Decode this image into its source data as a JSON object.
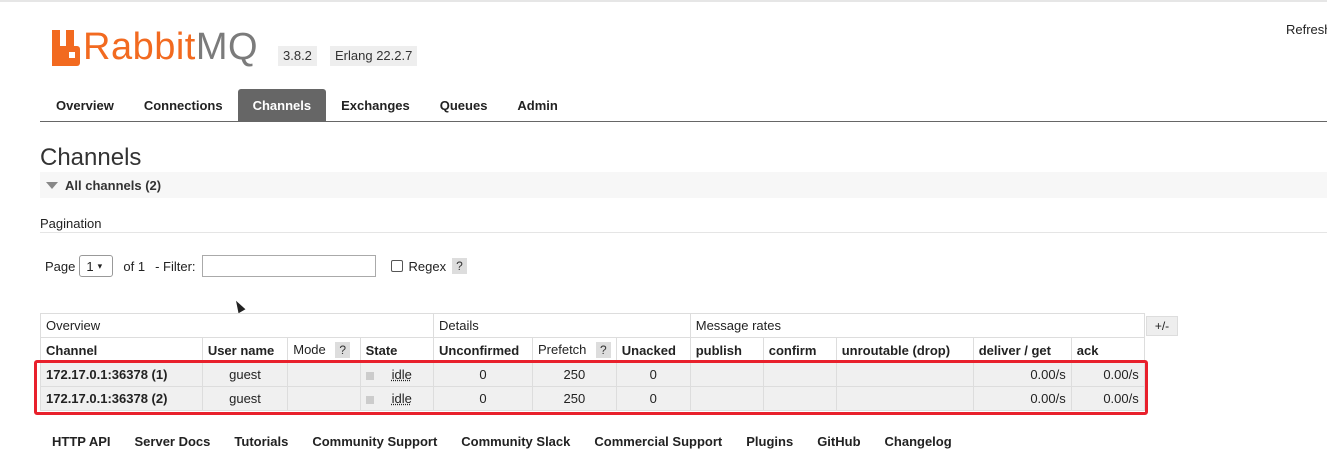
{
  "app": {
    "logo_rabbit": "Rabbit",
    "logo_mq": "MQ",
    "version": "3.8.2",
    "erlang": "Erlang 22.2.7",
    "refresh": "Refresh"
  },
  "tabs": [
    {
      "label": "Overview"
    },
    {
      "label": "Connections"
    },
    {
      "label": "Channels",
      "active": true
    },
    {
      "label": "Exchanges"
    },
    {
      "label": "Queues"
    },
    {
      "label": "Admin"
    }
  ],
  "page": {
    "title": "Channels",
    "section": "All channels (2)",
    "pagination_label": "Pagination"
  },
  "pager": {
    "page_label": "Page",
    "page_value": "1",
    "of_label": "of 1",
    "filter_label": "- Filter:",
    "filter_value": "",
    "regex_label": "Regex",
    "help": "?"
  },
  "table": {
    "groups": [
      "Overview",
      "Details",
      "Message rates"
    ],
    "columns": [
      "Channel",
      "User name",
      "Mode",
      "State",
      "Unconfirmed",
      "Prefetch",
      "Unacked",
      "publish",
      "confirm",
      "unroutable (drop)",
      "deliver / get",
      "ack"
    ],
    "plus_minus": "+/-",
    "rows": [
      {
        "channel": "172.17.0.1:36378 (1)",
        "user": "guest",
        "mode": "",
        "state": "idle",
        "unconfirmed": "0",
        "prefetch": "250",
        "unacked": "0",
        "publish": "",
        "confirm": "",
        "unroutable": "",
        "deliver": "0.00/s",
        "ack": "0.00/s"
      },
      {
        "channel": "172.17.0.1:36378 (2)",
        "user": "guest",
        "mode": "",
        "state": "idle",
        "unconfirmed": "0",
        "prefetch": "250",
        "unacked": "0",
        "publish": "",
        "confirm": "",
        "unroutable": "",
        "deliver": "0.00/s",
        "ack": "0.00/s"
      }
    ]
  },
  "footer": [
    "HTTP API",
    "Server Docs",
    "Tutorials",
    "Community Support",
    "Community Slack",
    "Commercial Support",
    "Plugins",
    "GitHub",
    "Changelog"
  ],
  "colors": {
    "brand": "#f26a20",
    "highlight": "#e8202c",
    "active_tab": "#666666"
  }
}
